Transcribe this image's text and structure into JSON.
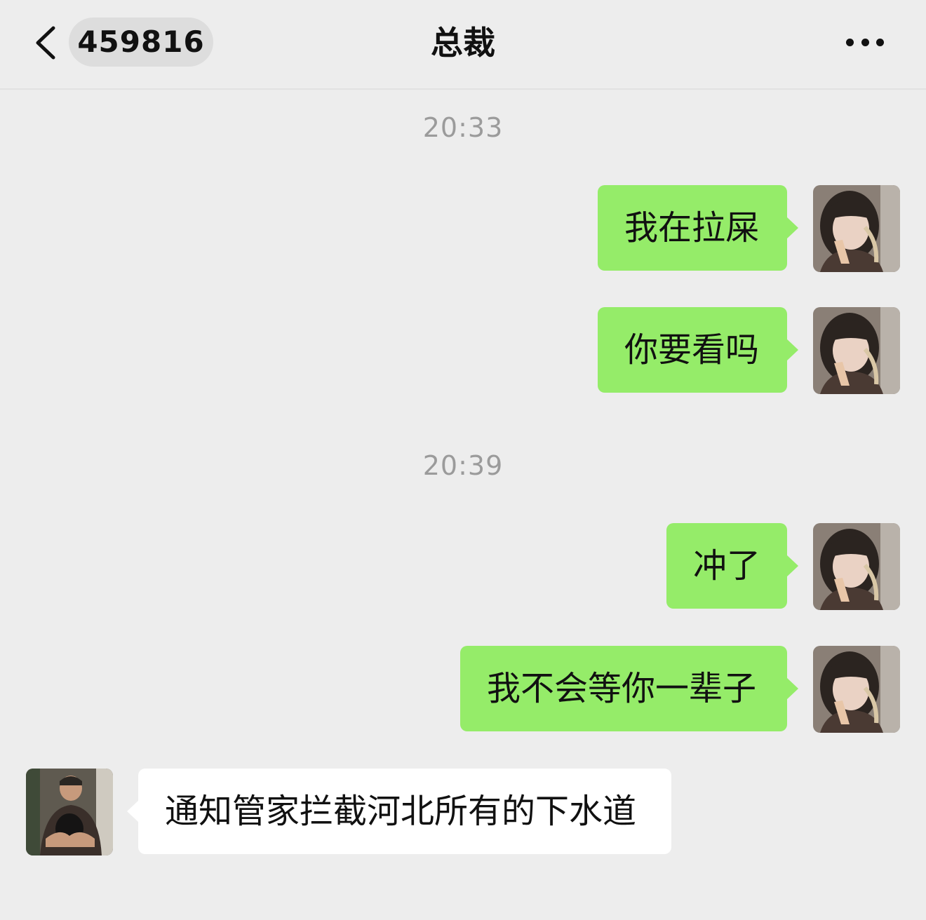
{
  "header": {
    "unread_count": "459816",
    "title": "总裁"
  },
  "messages": [
    {
      "type": "timestamp",
      "text": "20:33"
    },
    {
      "type": "sent",
      "text": "我在拉屎"
    },
    {
      "type": "sent",
      "text": "你要看吗"
    },
    {
      "type": "timestamp",
      "text": "20:39"
    },
    {
      "type": "sent",
      "text": "冲了"
    },
    {
      "type": "sent",
      "text": "我不会等你一辈子"
    },
    {
      "type": "received",
      "text": "通知管家拦截河北所有的下水道"
    }
  ],
  "colors": {
    "background": "#EDEDED",
    "sent_bubble": "#95EC69",
    "received_bubble": "#FFFFFF",
    "timestamp_text": "#9B9B9B",
    "unread_pill": "#DDDDDD"
  },
  "icons": {
    "back": "chevron-left-icon",
    "more": "more-dots-icon"
  }
}
